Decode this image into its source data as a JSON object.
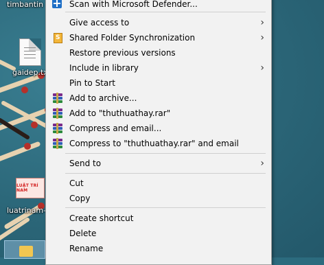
{
  "desktop": {
    "icons": [
      {
        "label": "timbantin"
      },
      {
        "label": "gaidep.txt"
      },
      {
        "label": "luatrinam-"
      }
    ],
    "thumbnail_text": "LUẬT TRÍ NAM"
  },
  "menu": {
    "items": [
      {
        "label": "Scan with Microsoft Defender...",
        "icon": "defender-icon"
      },
      {
        "label": "Give access to",
        "submenu": true
      },
      {
        "label": "Shared Folder Synchronization",
        "icon": "sync-icon",
        "submenu": true
      },
      {
        "label": "Restore previous versions"
      },
      {
        "label": "Include in library",
        "submenu": true
      },
      {
        "label": "Pin to Start"
      },
      {
        "label": "Add to archive...",
        "icon": "winrar-icon"
      },
      {
        "label": "Add to \"thuthuathay.rar\"",
        "icon": "winrar-icon"
      },
      {
        "label": "Compress and email...",
        "icon": "winrar-icon"
      },
      {
        "label": "Compress to \"thuthuathay.rar\" and email",
        "icon": "winrar-icon"
      },
      {
        "label": "Send to",
        "submenu": true
      },
      {
        "label": "Cut"
      },
      {
        "label": "Copy"
      },
      {
        "label": "Create shortcut"
      },
      {
        "label": "Delete"
      },
      {
        "label": "Rename"
      }
    ],
    "arrow_glyph": "›"
  },
  "colors": {
    "desktop": "#2b6678",
    "menu_bg": "#f2f2f2",
    "separator": "#cfcfcf"
  }
}
